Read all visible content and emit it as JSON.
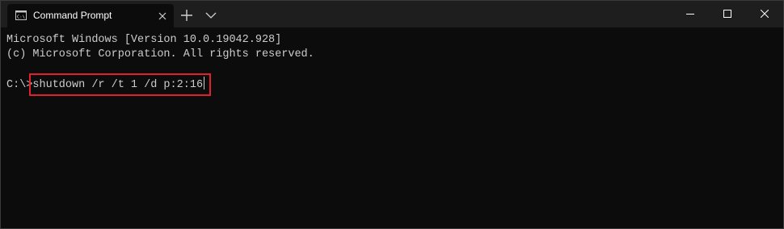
{
  "window": {
    "tab_title": "Command Prompt",
    "icons": {
      "tab": "cmd-icon",
      "tab_close": "close-icon",
      "new_tab": "plus-icon",
      "dropdown": "chevron-down-icon",
      "minimize": "minimize-icon",
      "maximize": "maximize-icon",
      "close": "close-icon"
    }
  },
  "console": {
    "line1": "Microsoft Windows [Version 10.0.19042.928]",
    "line2": "(c) Microsoft Corporation. All rights reserved.",
    "prompt": "C:\\>",
    "command": "shutdown /r /t 1 /d p:2:16"
  },
  "colors": {
    "titlebar": "#1e1e1e",
    "background": "#0c0c0c",
    "text": "#cccccc",
    "highlight": "#e0212b"
  }
}
